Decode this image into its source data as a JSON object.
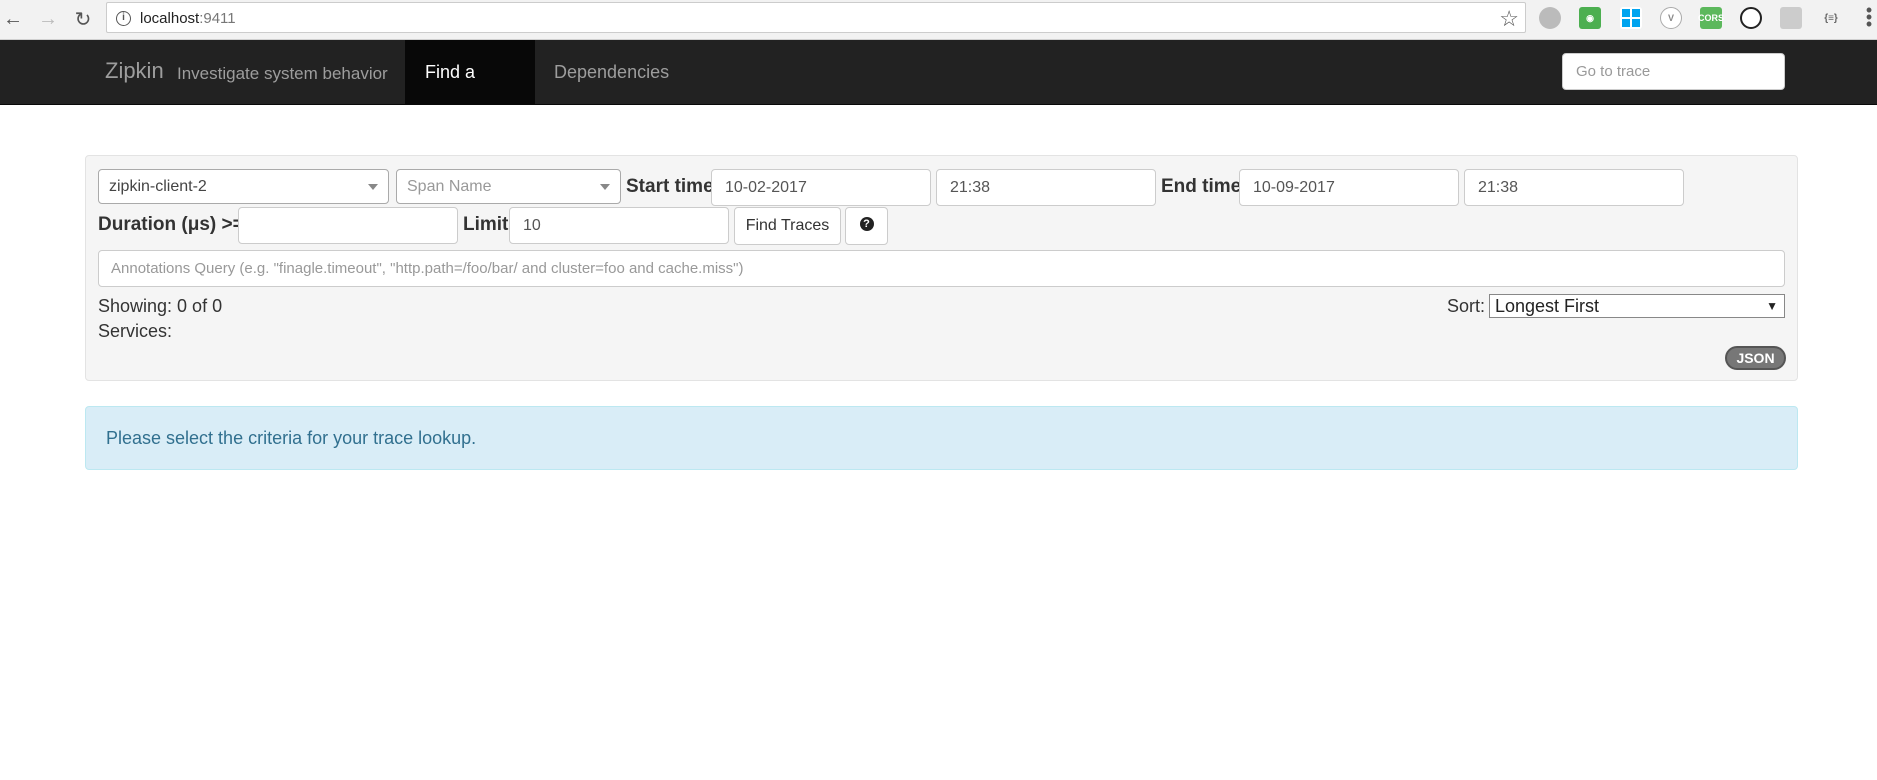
{
  "browser": {
    "url_host": "localhost",
    "url_port": ":9411"
  },
  "navbar": {
    "brand": "Zipkin",
    "tagline": "Investigate system behavior",
    "tabs": [
      {
        "label": "Find a trace",
        "active": true
      },
      {
        "label": "Dependencies",
        "active": false
      }
    ],
    "goto_placeholder": "Go to trace"
  },
  "search": {
    "service_value": "zipkin-client-2",
    "span_placeholder": "Span Name",
    "start_label": "Start time",
    "start_date": "10-02-2017",
    "start_time": "21:38",
    "end_label": "End time",
    "end_date": "10-09-2017",
    "end_time": "21:38",
    "duration_label": "Duration (μs) >=",
    "duration_value": "",
    "limit_label": "Limit",
    "limit_value": "10",
    "find_button": "Find Traces",
    "annotations_placeholder": "Annotations Query (e.g. \"finagle.timeout\", \"http.path=/foo/bar/ and cluster=foo and cache.miss\")",
    "showing": "Showing: 0 of 0",
    "services": "Services:",
    "sort_label": "Sort:",
    "sort_value": "Longest First",
    "json_badge": "JSON"
  },
  "alert": {
    "message": "Please select the criteria for your trace lookup."
  }
}
